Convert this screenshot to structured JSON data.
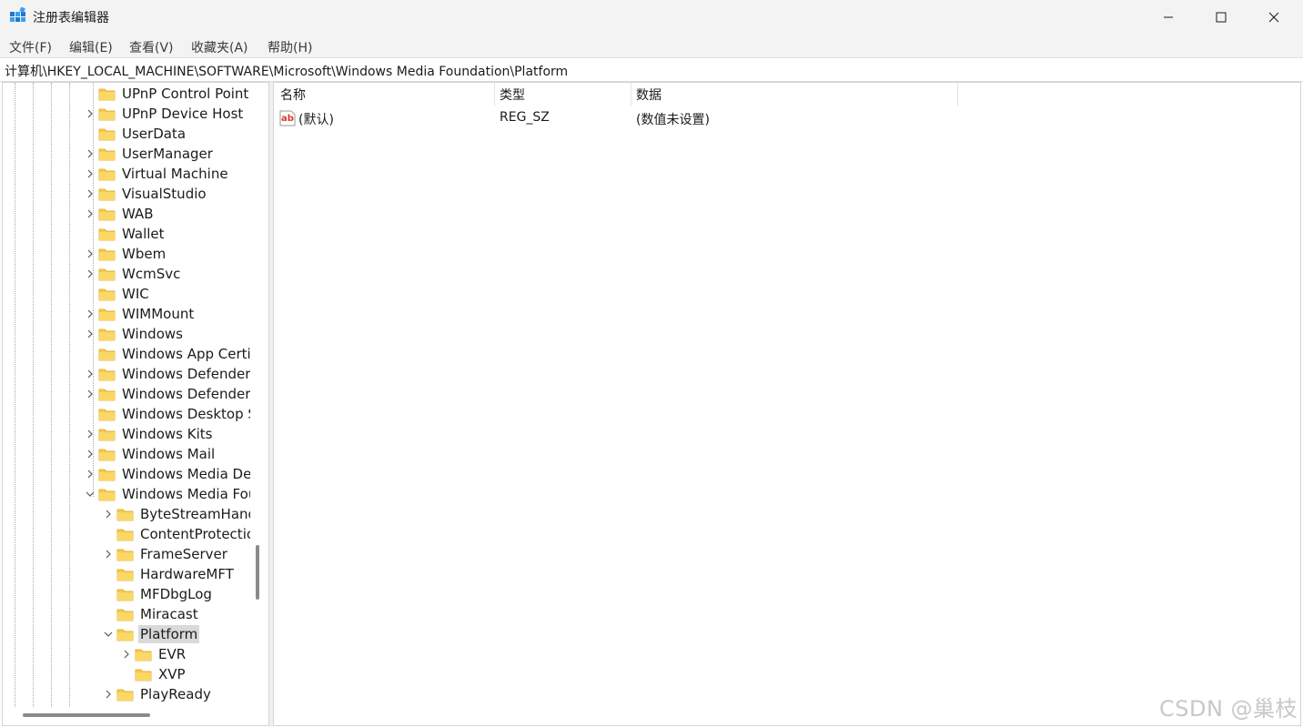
{
  "window": {
    "title": "注册表编辑器",
    "controls": {
      "minimize": "minimize",
      "maximize": "maximize",
      "close": "close"
    }
  },
  "menu": [
    {
      "label": "文件(F)"
    },
    {
      "label": "编辑(E)"
    },
    {
      "label": "查看(V)"
    },
    {
      "label": "收藏夹(A)"
    },
    {
      "label": "帮助(H)"
    }
  ],
  "address": {
    "path": "计算机\\HKEY_LOCAL_MACHINE\\SOFTWARE\\Microsoft\\Windows Media Foundation\\Platform"
  },
  "tree": {
    "nodes": [
      {
        "label": "UPnP Control Point",
        "expander": "none"
      },
      {
        "label": "UPnP Device Host",
        "expander": "collapsed"
      },
      {
        "label": "UserData",
        "expander": "none"
      },
      {
        "label": "UserManager",
        "expander": "collapsed"
      },
      {
        "label": "Virtual Machine",
        "expander": "collapsed"
      },
      {
        "label": "VisualStudio",
        "expander": "collapsed"
      },
      {
        "label": "WAB",
        "expander": "collapsed"
      },
      {
        "label": "Wallet",
        "expander": "none"
      },
      {
        "label": "Wbem",
        "expander": "collapsed"
      },
      {
        "label": "WcmSvc",
        "expander": "collapsed"
      },
      {
        "label": "WIC",
        "expander": "none"
      },
      {
        "label": "WIMMount",
        "expander": "collapsed"
      },
      {
        "label": "Windows",
        "expander": "collapsed"
      },
      {
        "label": "Windows App Certi",
        "expander": "none"
      },
      {
        "label": "Windows Defender",
        "expander": "collapsed"
      },
      {
        "label": "Windows Defender",
        "expander": "collapsed"
      },
      {
        "label": "Windows Desktop S",
        "expander": "none"
      },
      {
        "label": "Windows Kits",
        "expander": "collapsed"
      },
      {
        "label": "Windows Mail",
        "expander": "collapsed"
      },
      {
        "label": "Windows Media De",
        "expander": "collapsed"
      },
      {
        "label": "Windows Media Fou",
        "expander": "expanded"
      },
      {
        "label": "ByteStreamHand",
        "expander": "collapsed"
      },
      {
        "label": "ContentProtectic",
        "expander": "none"
      },
      {
        "label": "FrameServer",
        "expander": "collapsed"
      },
      {
        "label": "HardwareMFT",
        "expander": "none"
      },
      {
        "label": "MFDbgLog",
        "expander": "none"
      },
      {
        "label": "Miracast",
        "expander": "none"
      },
      {
        "label": "Platform",
        "expander": "expanded",
        "selected": true
      },
      {
        "label": "EVR",
        "expander": "collapsed"
      },
      {
        "label": "XVP",
        "expander": "none"
      },
      {
        "label": "PlayReady",
        "expander": "collapsed"
      }
    ]
  },
  "list": {
    "headers": {
      "name": "名称",
      "type": "类型",
      "data": "数据"
    },
    "rows": [
      {
        "icon": "string-value-icon",
        "name": "(默认)",
        "type": "REG_SZ",
        "data": "(数值未设置)"
      }
    ]
  },
  "watermark": "CSDN @巢枝",
  "colors": {
    "folder": "#f8c94a",
    "selection": "#d9d9d9",
    "chrome": "#f3f3f3",
    "close_red": "#e81123"
  }
}
